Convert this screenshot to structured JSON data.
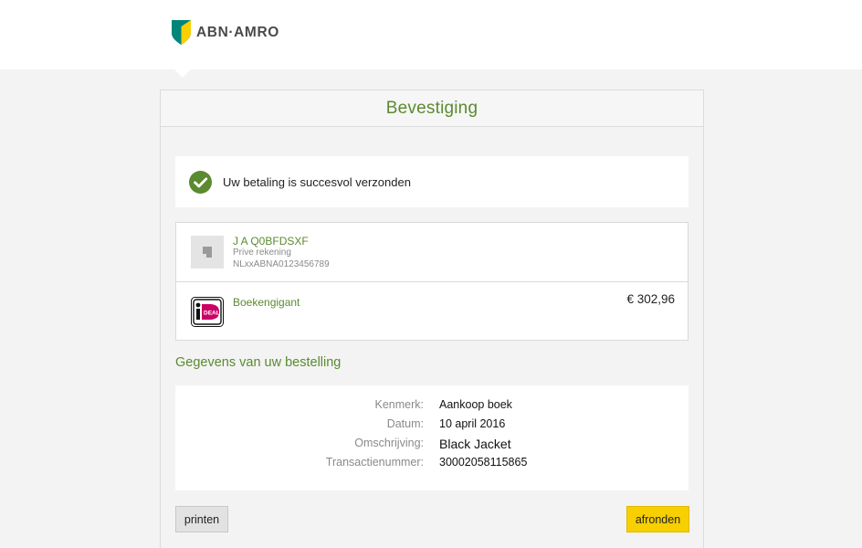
{
  "header": {
    "logo_text": "ABN·AMRO",
    "logo_colors": {
      "green": "#00857a",
      "yellow": "#f8cf00"
    }
  },
  "page": {
    "title": "Bevestiging"
  },
  "success": {
    "message": "Uw betaling is succesvol verzonden",
    "icon": "check-circle-icon",
    "color": "#5b8a2f"
  },
  "payer": {
    "name": "J A Q0BFDSXF",
    "account_type": "Prive rekening",
    "iban": "NLxxABNA0123456789",
    "icon": "bank-icon"
  },
  "payee": {
    "name": "Boekengigant",
    "amount": "€ 302,96",
    "icon": "ideal-logo-icon"
  },
  "order": {
    "section_title": "Gegevens van uw bestelling",
    "rows": [
      {
        "label": "Kenmerk:",
        "value": "Aankoop boek"
      },
      {
        "label": "Datum:",
        "value": "10 april 2016"
      },
      {
        "label": "Omschrijving:",
        "value": "Black Jacket"
      },
      {
        "label": "Transactienummer:",
        "value": "30002058115865"
      }
    ]
  },
  "actions": {
    "print_label": "printen",
    "finish_label": "afronden",
    "finish_color": "#f8cf00"
  }
}
